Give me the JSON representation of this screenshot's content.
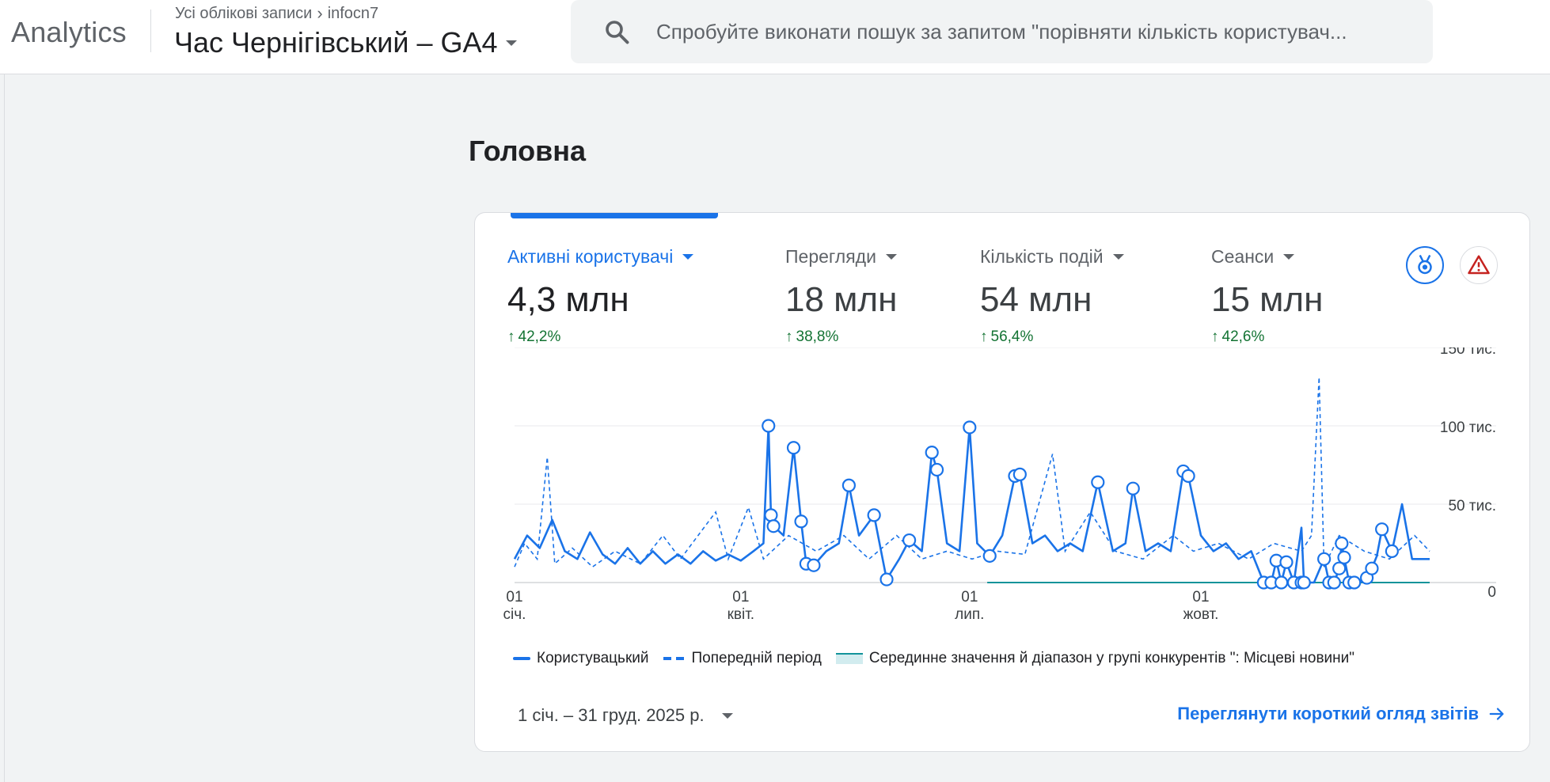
{
  "app": {
    "brand": "Analytics"
  },
  "breadcrumb": {
    "root": "Усі облікові записи",
    "account": "infocn7"
  },
  "property": {
    "name": "Час Чернігівський – GA4"
  },
  "search": {
    "placeholder": "Спробуйте виконати пошук за запитом \"порівняти кількість користувач..."
  },
  "page": {
    "title": "Головна"
  },
  "metrics": [
    {
      "label": "Активні користувачі",
      "value": "4,3 млн",
      "change": "42,2%",
      "active": true
    },
    {
      "label": "Перегляди",
      "value": "18 млн",
      "change": "38,8%",
      "active": false
    },
    {
      "label": "Кількість подій",
      "value": "54 млн",
      "change": "56,4%",
      "active": false
    },
    {
      "label": "Сеанси",
      "value": "15 млн",
      "change": "42,6%",
      "active": false
    }
  ],
  "icons": {
    "medal": "medal-icon",
    "warning": "warning-icon",
    "search": "search-icon",
    "arrow": "arrow-right-icon"
  },
  "colors": {
    "accent": "#1a73e8",
    "positive": "#137333",
    "benchmark": "#12939a",
    "warning": "#c5221f"
  },
  "legend": {
    "current": "Користувацький",
    "previous": "Попередній період",
    "benchmark": "Серединне значення й діапазон у групі конкурентів \": Місцеві новини\""
  },
  "footer": {
    "date_range": "1 січ. – 31 груд. 2025 р.",
    "view_link": "Переглянути короткий огляд звітів"
  },
  "chart_data": {
    "type": "line",
    "x_range": [
      "2025-01-01",
      "2025-12-31"
    ],
    "ylim": [
      0,
      150000
    ],
    "y_ticks": [
      "150 тис.",
      "100 тис.",
      "50 тис.",
      "0"
    ],
    "y_tick_values": [
      150000,
      100000,
      50000,
      0
    ],
    "x_ticks": [
      {
        "day": "01",
        "month": "січ.",
        "date": "2025-01-01"
      },
      {
        "day": "01",
        "month": "квіт.",
        "date": "2025-04-01"
      },
      {
        "day": "01",
        "month": "лип.",
        "date": "2025-07-01"
      },
      {
        "day": "01",
        "month": "жовт.",
        "date": "2025-10-01"
      }
    ],
    "series": [
      {
        "name": "Користувацький",
        "style": "solid",
        "points": [
          [
            "2025-01-01",
            15000
          ],
          [
            "2025-01-06",
            30000
          ],
          [
            "2025-01-11",
            22000
          ],
          [
            "2025-01-16",
            40000
          ],
          [
            "2025-01-21",
            20000
          ],
          [
            "2025-01-26",
            15000
          ],
          [
            "2025-01-31",
            32000
          ],
          [
            "2025-02-05",
            18000
          ],
          [
            "2025-02-10",
            12000
          ],
          [
            "2025-02-15",
            22000
          ],
          [
            "2025-02-20",
            12000
          ],
          [
            "2025-02-25",
            20000
          ],
          [
            "2025-03-02",
            12000
          ],
          [
            "2025-03-07",
            18000
          ],
          [
            "2025-03-12",
            12000
          ],
          [
            "2025-03-17",
            20000
          ],
          [
            "2025-03-22",
            14000
          ],
          [
            "2025-03-27",
            18000
          ],
          [
            "2025-04-01",
            14000
          ],
          [
            "2025-04-06",
            20000
          ],
          [
            "2025-04-10",
            25000
          ],
          [
            "2025-04-12",
            100000
          ],
          [
            "2025-04-13",
            43000
          ],
          [
            "2025-04-14",
            36000
          ],
          [
            "2025-04-18",
            30000
          ],
          [
            "2025-04-22",
            86000
          ],
          [
            "2025-04-25",
            39000
          ],
          [
            "2025-04-27",
            12000
          ],
          [
            "2025-04-30",
            11000
          ],
          [
            "2025-05-05",
            20000
          ],
          [
            "2025-05-10",
            25000
          ],
          [
            "2025-05-14",
            62000
          ],
          [
            "2025-05-18",
            30000
          ],
          [
            "2025-05-24",
            43000
          ],
          [
            "2025-05-29",
            2000
          ],
          [
            "2025-06-03",
            15000
          ],
          [
            "2025-06-07",
            27000
          ],
          [
            "2025-06-12",
            20000
          ],
          [
            "2025-06-16",
            83000
          ],
          [
            "2025-06-18",
            72000
          ],
          [
            "2025-06-22",
            25000
          ],
          [
            "2025-06-27",
            20000
          ],
          [
            "2025-07-01",
            99000
          ],
          [
            "2025-07-04",
            25000
          ],
          [
            "2025-07-09",
            17000
          ],
          [
            "2025-07-14",
            30000
          ],
          [
            "2025-07-19",
            68000
          ],
          [
            "2025-07-21",
            69000
          ],
          [
            "2025-07-26",
            25000
          ],
          [
            "2025-07-31",
            30000
          ],
          [
            "2025-08-05",
            20000
          ],
          [
            "2025-08-10",
            25000
          ],
          [
            "2025-08-15",
            20000
          ],
          [
            "2025-08-21",
            64000
          ],
          [
            "2025-08-27",
            20000
          ],
          [
            "2025-09-01",
            25000
          ],
          [
            "2025-09-04",
            60000
          ],
          [
            "2025-09-09",
            20000
          ],
          [
            "2025-09-14",
            25000
          ],
          [
            "2025-09-19",
            20000
          ],
          [
            "2025-09-24",
            71000
          ],
          [
            "2025-09-26",
            68000
          ],
          [
            "2025-10-01",
            30000
          ],
          [
            "2025-10-06",
            20000
          ],
          [
            "2025-10-11",
            25000
          ],
          [
            "2025-10-16",
            15000
          ],
          [
            "2025-10-21",
            20000
          ],
          [
            "2025-10-26",
            0
          ],
          [
            "2025-10-29",
            0
          ],
          [
            "2025-10-31",
            14000
          ],
          [
            "2025-11-02",
            0
          ],
          [
            "2025-11-04",
            13000
          ],
          [
            "2025-11-07",
            0
          ],
          [
            "2025-11-10",
            35000
          ],
          [
            "2025-11-11",
            0
          ],
          [
            "2025-11-15",
            0
          ],
          [
            "2025-11-19",
            15000
          ],
          [
            "2025-11-21",
            0
          ],
          [
            "2025-11-23",
            0
          ],
          [
            "2025-11-25",
            9000
          ],
          [
            "2025-11-26",
            25000
          ],
          [
            "2025-11-27",
            16000
          ],
          [
            "2025-11-29",
            0
          ],
          [
            "2025-12-01",
            0
          ],
          [
            "2025-12-03",
            0
          ],
          [
            "2025-12-06",
            3000
          ],
          [
            "2025-12-08",
            9000
          ],
          [
            "2025-12-10",
            17000
          ],
          [
            "2025-12-12",
            34000
          ],
          [
            "2025-12-16",
            20000
          ],
          [
            "2025-12-20",
            50000
          ],
          [
            "2025-12-24",
            15000
          ],
          [
            "2025-12-31",
            15000
          ]
        ],
        "markers": [
          [
            "2025-04-12",
            100000
          ],
          [
            "2025-04-13",
            43000
          ],
          [
            "2025-04-14",
            36000
          ],
          [
            "2025-04-22",
            86000
          ],
          [
            "2025-04-25",
            39000
          ],
          [
            "2025-04-27",
            12000
          ],
          [
            "2025-04-30",
            11000
          ],
          [
            "2025-05-14",
            62000
          ],
          [
            "2025-05-24",
            43000
          ],
          [
            "2025-05-29",
            2000
          ],
          [
            "2025-06-07",
            27000
          ],
          [
            "2025-06-16",
            83000
          ],
          [
            "2025-06-18",
            72000
          ],
          [
            "2025-07-01",
            99000
          ],
          [
            "2025-07-09",
            17000
          ],
          [
            "2025-07-19",
            68000
          ],
          [
            "2025-07-21",
            69000
          ],
          [
            "2025-08-21",
            64000
          ],
          [
            "2025-09-04",
            60000
          ],
          [
            "2025-09-24",
            71000
          ],
          [
            "2025-09-26",
            68000
          ],
          [
            "2025-10-26",
            0
          ],
          [
            "2025-10-29",
            0
          ],
          [
            "2025-10-31",
            14000
          ],
          [
            "2025-11-02",
            0
          ],
          [
            "2025-11-04",
            13000
          ],
          [
            "2025-11-07",
            0
          ],
          [
            "2025-11-10",
            0
          ],
          [
            "2025-11-11",
            0
          ],
          [
            "2025-11-19",
            15000
          ],
          [
            "2025-11-21",
            0
          ],
          [
            "2025-11-23",
            0
          ],
          [
            "2025-11-25",
            9000
          ],
          [
            "2025-11-26",
            25000
          ],
          [
            "2025-11-27",
            16000
          ],
          [
            "2025-11-29",
            0
          ],
          [
            "2025-12-01",
            0
          ],
          [
            "2025-12-06",
            3000
          ],
          [
            "2025-12-08",
            9000
          ],
          [
            "2025-12-12",
            34000
          ],
          [
            "2025-12-16",
            20000
          ]
        ]
      },
      {
        "name": "Попередній період",
        "style": "dashed",
        "points": [
          [
            "2025-01-01",
            10000
          ],
          [
            "2025-01-05",
            25000
          ],
          [
            "2025-01-10",
            15000
          ],
          [
            "2025-01-14",
            80000
          ],
          [
            "2025-01-17",
            12000
          ],
          [
            "2025-01-24",
            22000
          ],
          [
            "2025-02-01",
            10000
          ],
          [
            "2025-02-10",
            20000
          ],
          [
            "2025-02-20",
            12000
          ],
          [
            "2025-03-01",
            30000
          ],
          [
            "2025-03-08",
            15000
          ],
          [
            "2025-03-15",
            30000
          ],
          [
            "2025-03-22",
            45000
          ],
          [
            "2025-03-27",
            15000
          ],
          [
            "2025-04-04",
            48000
          ],
          [
            "2025-04-10",
            15000
          ],
          [
            "2025-04-20",
            30000
          ],
          [
            "2025-05-01",
            20000
          ],
          [
            "2025-05-12",
            30000
          ],
          [
            "2025-05-22",
            15000
          ],
          [
            "2025-06-02",
            30000
          ],
          [
            "2025-06-12",
            15000
          ],
          [
            "2025-06-22",
            20000
          ],
          [
            "2025-07-02",
            15000
          ],
          [
            "2025-07-12",
            20000
          ],
          [
            "2025-07-23",
            18000
          ],
          [
            "2025-08-03",
            82000
          ],
          [
            "2025-08-08",
            20000
          ],
          [
            "2025-08-18",
            45000
          ],
          [
            "2025-08-28",
            20000
          ],
          [
            "2025-09-08",
            15000
          ],
          [
            "2025-09-20",
            30000
          ],
          [
            "2025-09-28",
            20000
          ],
          [
            "2025-10-08",
            25000
          ],
          [
            "2025-10-20",
            15000
          ],
          [
            "2025-10-30",
            25000
          ],
          [
            "2025-11-10",
            20000
          ],
          [
            "2025-11-14",
            30000
          ],
          [
            "2025-11-17",
            131000
          ],
          [
            "2025-11-19",
            10000
          ],
          [
            "2025-11-25",
            30000
          ],
          [
            "2025-12-05",
            20000
          ],
          [
            "2025-12-15",
            15000
          ],
          [
            "2025-12-25",
            30000
          ],
          [
            "2025-12-31",
            20000
          ]
        ]
      },
      {
        "name": "Серединне значення й діапазон у групі конкурентів \": Місцеві новини\"",
        "style": "band",
        "points": [
          [
            "2025-07-08",
            0
          ],
          [
            "2025-12-31",
            0
          ]
        ]
      }
    ]
  }
}
